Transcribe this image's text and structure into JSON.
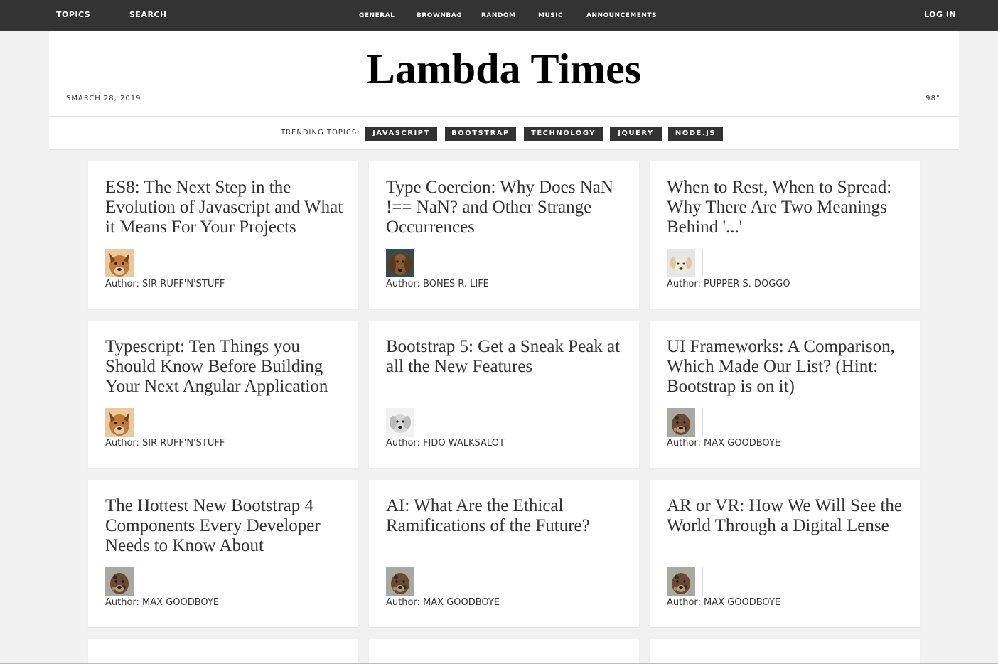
{
  "topbar": {
    "topics": "TOPICS",
    "search": "SEARCH",
    "links": [
      "GENERAL",
      "BROWNBAG",
      "RANDOM",
      "MUSIC",
      "ANNOUNCEMENTS"
    ],
    "login": "LOG IN"
  },
  "header": {
    "title": "Lambda Times",
    "date": "SMARCH 28, 2019",
    "temp": "98°"
  },
  "trending": {
    "label": "TRENDING TOPICS:",
    "tabs": [
      "JAVASCRIPT",
      "BOOTSTRAP",
      "TECHNOLOGY",
      "JQUERY",
      "NODE.JS"
    ]
  },
  "colors": {
    "topbar": "#333333",
    "background": "#f1f1f1",
    "tab": "#333333"
  },
  "cards": [
    {
      "headline": "ES8: The Next Step in the Evolution of Javascript and What it Means For Your Projects",
      "author": "Author: SIR RUFF'N'STUFF",
      "avatar": "dog-avatar-orange"
    },
    {
      "headline": "Type Coercion: Why Does NaN !== NaN? and Other Strange Occurrences",
      "author": "Author: BONES R. LIFE",
      "avatar": "dog-avatar-brown"
    },
    {
      "headline": "When to Rest, When to Spread: Why There Are Two Meanings Behind '...'",
      "author": "Author: PUPPER S. DOGGO",
      "avatar": "dog-avatar-white"
    },
    {
      "headline": "Typescript: Ten Things you Should Know Before Building Your Next Angular Application",
      "author": "Author: SIR RUFF'N'STUFF",
      "avatar": "dog-avatar-orange"
    },
    {
      "headline": "Bootstrap 5: Get a Sneak Peak at all the New Features",
      "author": "Author: FIDO WALKSALOT",
      "avatar": "dog-avatar-gray"
    },
    {
      "headline": "UI Frameworks: A Comparison, Which Made Our List? (Hint: Bootstrap is on it)",
      "author": "Author: MAX GOODBOYE",
      "avatar": "dog-avatar-merle"
    },
    {
      "headline": "The Hottest New Bootstrap 4 Components Every Developer Needs to Know About",
      "author": "Author: MAX GOODBOYE",
      "avatar": "dog-avatar-merle"
    },
    {
      "headline": "AI: What Are the Ethical Ramifications of the Future?",
      "author": "Author: MAX GOODBOYE",
      "avatar": "dog-avatar-merle"
    },
    {
      "headline": "AR or VR: How We Will See the World Through a Digital Lense",
      "author": "Author: MAX GOODBOYE",
      "avatar": "dog-avatar-merle"
    }
  ]
}
